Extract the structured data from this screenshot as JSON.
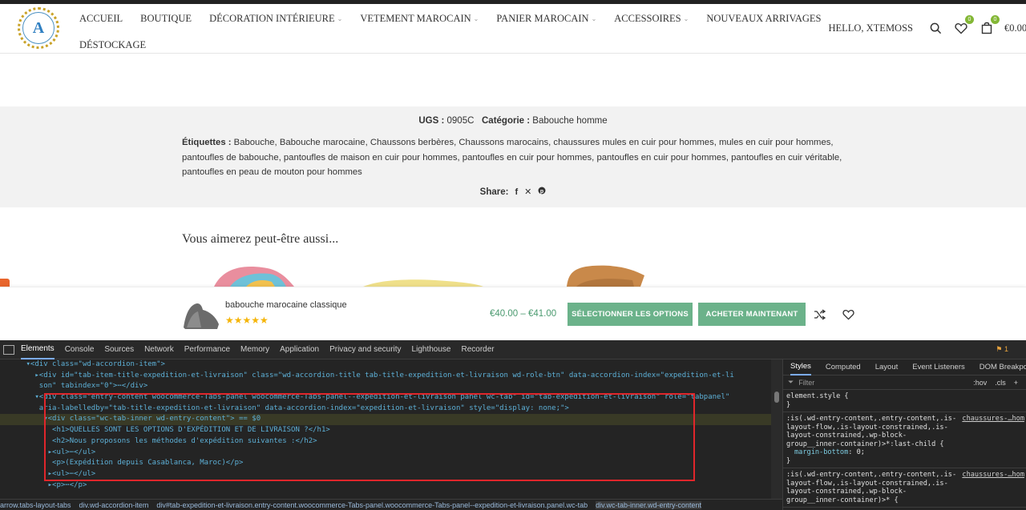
{
  "header": {
    "logo_letter": "A",
    "nav_row1": [
      {
        "label": "ACCUEIL",
        "dropdown": false
      },
      {
        "label": "BOUTIQUE",
        "dropdown": false
      },
      {
        "label": "DÉCORATION INTÉRIEURE",
        "dropdown": true
      },
      {
        "label": "VETEMENT MAROCAIN",
        "dropdown": true
      },
      {
        "label": "PANIER MAROCAIN",
        "dropdown": true
      },
      {
        "label": "ACCESSOIRES",
        "dropdown": true
      },
      {
        "label": "NOUVEAUX ARRIVAGES",
        "dropdown": false
      }
    ],
    "nav_row2": [
      {
        "label": "DÉSTOCKAGE",
        "dropdown": false
      }
    ],
    "greeting": "HELLO, XTEMOSS",
    "wishlist_count": "0",
    "cart_count": "0",
    "cart_total": "€0.00"
  },
  "meta": {
    "ugs_label": "UGS :",
    "ugs_value": "0905C",
    "category_label": "Catégorie :",
    "category_value": "Babouche homme",
    "tags_label": "Étiquettes :",
    "tags_text": "Babouche, Babouche marocaine, Chaussons berbères, Chaussons marocains, chaussures mules en cuir pour hommes, mules en cuir pour hommes, pantoufles de babouche, pantoufles de maison en cuir pour hommes, pantoufles en cuir pour hommes, pantoufles en cuir pour hommes, pantoufles en cuir véritable, pantoufles en peau de mouton pour hommes",
    "share_label": "Share:"
  },
  "related": {
    "title": "Vous aimerez peut-être aussi..."
  },
  "sticky": {
    "product_name": "babouche marocaine classique",
    "stars": "★★★★★",
    "price": "€40.00 – €41.00",
    "select_label": "SÉLECTIONNER LES OPTIONS",
    "buy_label": "ACHETER MAINTENANT"
  },
  "devtools": {
    "tabs": [
      "Elements",
      "Console",
      "Sources",
      "Network",
      "Performance",
      "Memory",
      "Application",
      "Privacy and security",
      "Lighthouse",
      "Recorder"
    ],
    "issues_count": "1",
    "lines": [
      {
        "indent": "      ",
        "text": "▾<div class=\"wd-accordion-item\">"
      },
      {
        "indent": "        ",
        "text": "▸<div id=\"tab-item-title-expedition-et-livraison\" class=\"wd-accordion-title tab-title-expedition-et-livraison wd-role-btn\" data-accordion-index=\"expedition-et-li"
      },
      {
        "indent": "         ",
        "text": "son\" tabindex=\"0\">⋯</div>"
      },
      {
        "indent": "        ",
        "text": "▾<div class=\"entry-content woocommerce-Tabs-panel woocommerce-Tabs-panel--expedition-et-livraison panel wc-tab\" id=\"tab-expedition-et-livraison\" role=\"tabpanel\""
      },
      {
        "indent": "         ",
        "text": "aria-labelledby=\"tab-title-expedition-et-livraison\" data-accordion-index=\"expedition-et-livraison\" style=\"display: none;\">"
      },
      {
        "indent": "          ",
        "text": "▾<div class=\"wc-tab-inner wd-entry-content\"> == $0"
      },
      {
        "indent": "            ",
        "text": "<h1>QUELLES SONT LES OPTIONS D'EXPÉDITION ET DE LIVRAISON ?</h1>"
      },
      {
        "indent": "            ",
        "text": "<h2>Nous proposons les méthodes d'expédition suivantes :</h2>"
      },
      {
        "indent": "           ",
        "text": "▸<ul>⋯</ul>"
      },
      {
        "indent": "            ",
        "text": "<p>(Expédition depuis Casablanca, Maroc)</p>"
      },
      {
        "indent": "           ",
        "text": "▸<ul>⋯</ul>"
      },
      {
        "indent": "           ",
        "text": "▸<p>⋯</p>"
      }
    ],
    "crumbs": [
      "arrow.tabs-layout-tabs",
      "div.wd-accordion-item",
      "div#tab-expedition-et-livraison.entry-content.woocommerce-Tabs-panel.woocommerce-Tabs-panel--expedition-et-livraison.panel.wc-tab",
      "div.wc-tab-inner.wd-entry-content"
    ],
    "styles_tabs": [
      "Styles",
      "Computed",
      "Layout",
      "Event Listeners",
      "DOM Breakpoints"
    ],
    "filter_placeholder": "Filter",
    "hov_label": ":hov",
    "cls_label": ".cls",
    "rule1": "element.style {",
    "rule1_end": "}",
    "rule2_selector": ":is(.wd-entry-content,.entry-content,.is-layout-flow,.is-layout-constrained,.is-layout-constrained,.wp-block-group__inner-container)>*:last-child {",
    "rule2_src": "chaussures-…hom",
    "rule2_prop": "margin-bottom",
    "rule2_val": "0;",
    "rule3_selector": ":is(.wd-entry-content,.entry-content,.is-layout-flow,.is-layout-constrained,.is-layout-constrained,.wp-block-group__inner-container)>* {",
    "rule3_src": "chaussures-…hom"
  }
}
